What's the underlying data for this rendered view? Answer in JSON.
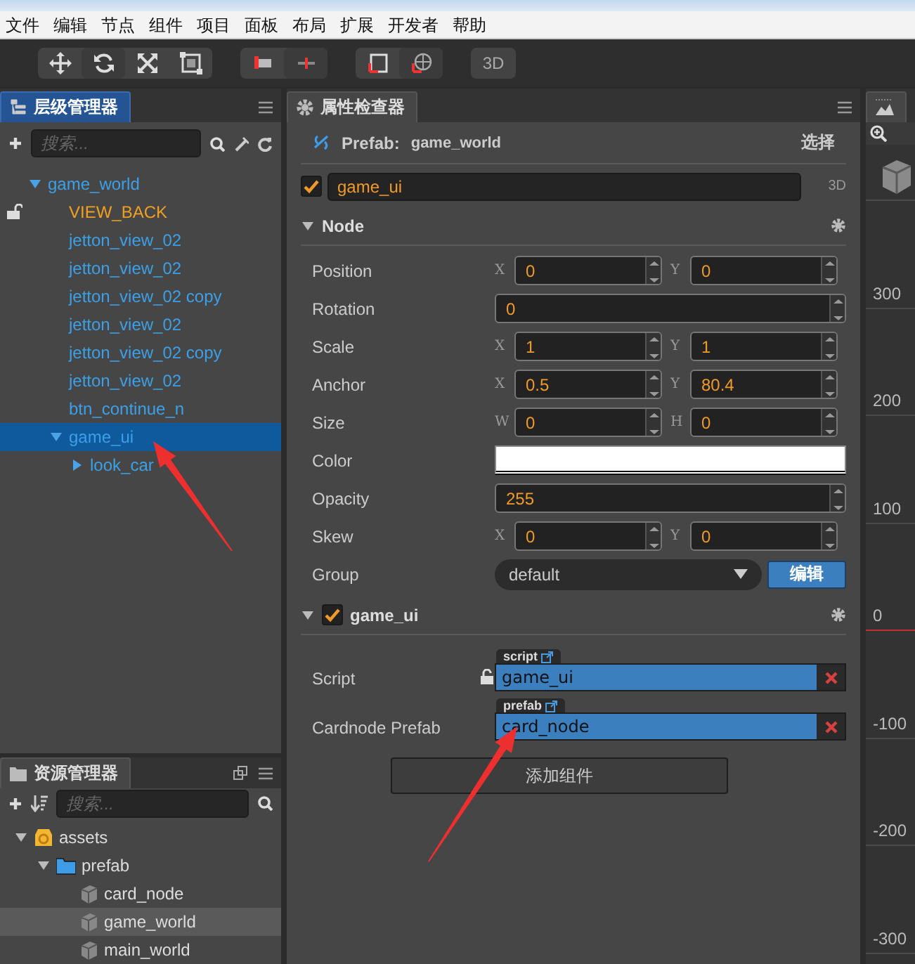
{
  "menu": [
    "文件",
    "编辑",
    "节点",
    "组件",
    "项目",
    "面板",
    "布局",
    "扩展",
    "开发者",
    "帮助"
  ],
  "toolbar": {
    "mode_button": "3D"
  },
  "hierarchy": {
    "title": "层级管理器",
    "search_placeholder": "搜索...",
    "nodes": [
      {
        "label": "game_world",
        "color": "#3ca0e8",
        "selected": false,
        "locked": false,
        "expanded": true,
        "children": [
          {
            "label": "VIEW_BACK",
            "color": "#f0a020",
            "selected": false,
            "locked": true
          },
          {
            "label": "jetton_view_02",
            "color": "#3ca0e8",
            "selected": false,
            "locked": false
          },
          {
            "label": "jetton_view_02",
            "color": "#3ca0e8",
            "selected": false,
            "locked": false
          },
          {
            "label": "jetton_view_02 copy",
            "color": "#3ca0e8",
            "selected": false,
            "locked": false
          },
          {
            "label": "jetton_view_02",
            "color": "#3ca0e8",
            "selected": false,
            "locked": false
          },
          {
            "label": "jetton_view_02 copy",
            "color": "#3ca0e8",
            "selected": false,
            "locked": false
          },
          {
            "label": "jetton_view_02",
            "color": "#3ca0e8",
            "selected": false,
            "locked": false
          },
          {
            "label": "btn_continue_n",
            "color": "#3ca0e8",
            "selected": false,
            "locked": false
          },
          {
            "label": "game_ui",
            "color": "#3ca0e8",
            "selected": true,
            "locked": false,
            "expanded": true,
            "children": [
              {
                "label": "look_car",
                "color": "#3ca0e8",
                "selected": false,
                "locked": false,
                "expanded": false
              }
            ]
          }
        ]
      }
    ]
  },
  "assets": {
    "title": "资源管理器",
    "search_placeholder": "搜索...",
    "nodes": [
      {
        "label": "assets",
        "kind": "db",
        "selected": false,
        "expanded": true,
        "children": [
          {
            "label": "prefab",
            "kind": "folder",
            "selected": false,
            "expanded": true,
            "children": [
              {
                "label": "card_node",
                "kind": "prefab",
                "selected": false
              },
              {
                "label": "game_world",
                "kind": "prefab",
                "selected": true
              },
              {
                "label": "main_world",
                "kind": "prefab",
                "selected": false
              }
            ]
          }
        ]
      }
    ]
  },
  "inspector": {
    "title": "属性检查器",
    "prefab": {
      "label": "Prefab:",
      "name": "game_world",
      "action": "选择"
    },
    "node": {
      "active": true,
      "name": "game_ui",
      "mode": "3D"
    },
    "sections": [
      {
        "title": "Node",
        "expanded": true,
        "properties": [
          {
            "kind": "pair",
            "label": "Position",
            "fields": [
              {
                "axis": "X",
                "value": "0"
              },
              {
                "axis": "Y",
                "value": "0"
              }
            ]
          },
          {
            "kind": "number",
            "label": "Rotation",
            "value": "0"
          },
          {
            "kind": "pair",
            "label": "Scale",
            "fields": [
              {
                "axis": "X",
                "value": "1"
              },
              {
                "axis": "Y",
                "value": "1"
              }
            ]
          },
          {
            "kind": "pair",
            "label": "Anchor",
            "fields": [
              {
                "axis": "X",
                "value": "0.5"
              },
              {
                "axis": "Y",
                "value": "80.4"
              }
            ]
          },
          {
            "kind": "pair",
            "label": "Size",
            "fields": [
              {
                "axis": "W",
                "value": "0"
              },
              {
                "axis": "H",
                "value": "0"
              }
            ]
          },
          {
            "kind": "color",
            "label": "Color",
            "color": "#ffffff"
          },
          {
            "kind": "number",
            "label": "Opacity",
            "value": "255"
          },
          {
            "kind": "pair",
            "label": "Skew",
            "fields": [
              {
                "axis": "X",
                "value": "0"
              },
              {
                "axis": "Y",
                "value": "0"
              }
            ]
          },
          {
            "kind": "select",
            "label": "Group",
            "value": "default",
            "button": "编辑"
          }
        ]
      },
      {
        "title": "game_ui",
        "expanded": true,
        "enabled": true,
        "properties": [
          {
            "kind": "asset",
            "label": "Script",
            "locked": true,
            "tag": "script",
            "value": "game_ui"
          },
          {
            "kind": "asset",
            "label": "Cardnode Prefab",
            "locked": false,
            "tag": "prefab",
            "value": "card_node"
          }
        ]
      }
    ],
    "add_button": "添加组件"
  },
  "scene": {
    "ruler": [
      {
        "label": "300",
        "origin": false
      },
      {
        "label": "200",
        "origin": false
      },
      {
        "label": "100",
        "origin": false
      },
      {
        "label": "0",
        "origin": true
      },
      {
        "label": "-100",
        "origin": false
      },
      {
        "label": "-200",
        "origin": false
      },
      {
        "label": "-300",
        "origin": false
      }
    ]
  }
}
